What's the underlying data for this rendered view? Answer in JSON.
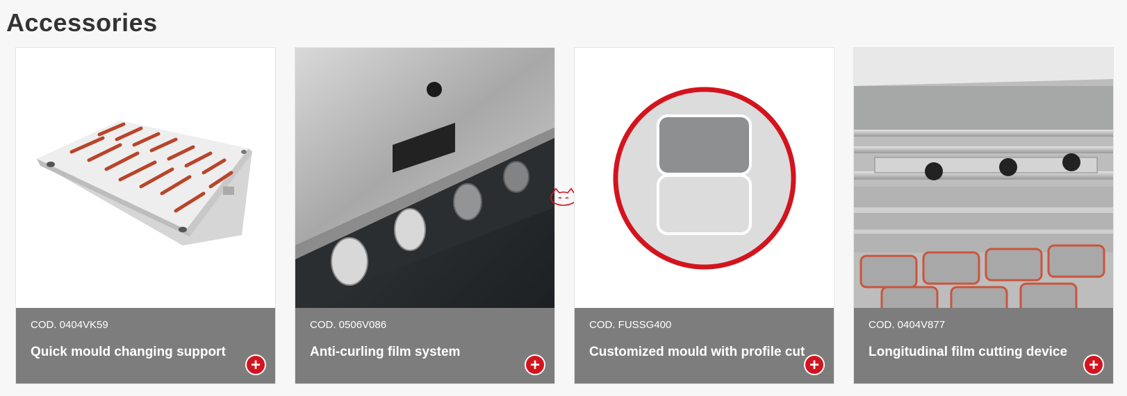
{
  "section": {
    "title": "Accessories"
  },
  "accent_color": "#d3141e",
  "info_bg_color": "#7d7d7d",
  "products": [
    {
      "code": "COD. 0404VK59",
      "name": "Quick mould changing support",
      "image": "mould-support-plate",
      "add_icon": "+"
    },
    {
      "code": "COD. 0506V086",
      "name": "Anti-curling film system",
      "image": "anti-curling-rollers",
      "add_icon": "+"
    },
    {
      "code": "COD. FUSSG400",
      "name": "Customized mould with profile cut",
      "image": "profile-cut-mould-icon",
      "add_icon": "+"
    },
    {
      "code": "COD. 0404V877",
      "name": "Longitudinal film cutting device",
      "image": "film-cutting-device",
      "add_icon": "+"
    }
  ]
}
